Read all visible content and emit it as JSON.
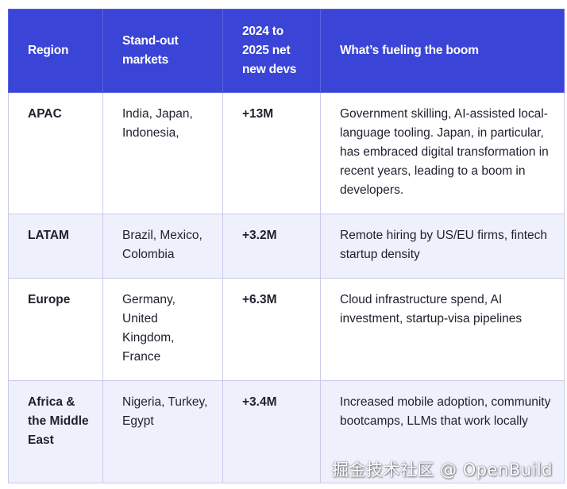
{
  "table": {
    "headers": [
      "Region",
      "Stand-out markets",
      "2024 to 2025 net new devs",
      "What’s fueling the boom"
    ],
    "rows": [
      {
        "region": "APAC",
        "markets": "India, Japan, Indonesia,",
        "growth": "+13M",
        "drivers": "Government skilling, AI-assisted local-language tooling. Japan, in particular, has embraced digital transformation in recent years, leading to a boom in developers."
      },
      {
        "region": "LATAM",
        "markets": "Brazil, Mexico, Colombia",
        "growth": "+3.2M",
        "drivers": "Remote hiring by US/EU firms, fintech startup density"
      },
      {
        "region": "Europe",
        "markets": "Germany, United Kingdom, France",
        "growth": "+6.3M",
        "drivers": "Cloud infrastructure spend, AI investment, startup-visa pipelines"
      },
      {
        "region": "Africa & the Middle East",
        "markets": "Nigeria, Turkey, Egypt",
        "growth": "+3.4M",
        "drivers": "Increased mobile adoption, community bootcamps, LLMs that work locally"
      }
    ]
  },
  "watermark": "掘金技术社区 @ OpenBuild",
  "colors": {
    "header_bg": "#3a44d6",
    "alt_row_bg": "#eef0fb",
    "border": "#c9cbe8"
  }
}
